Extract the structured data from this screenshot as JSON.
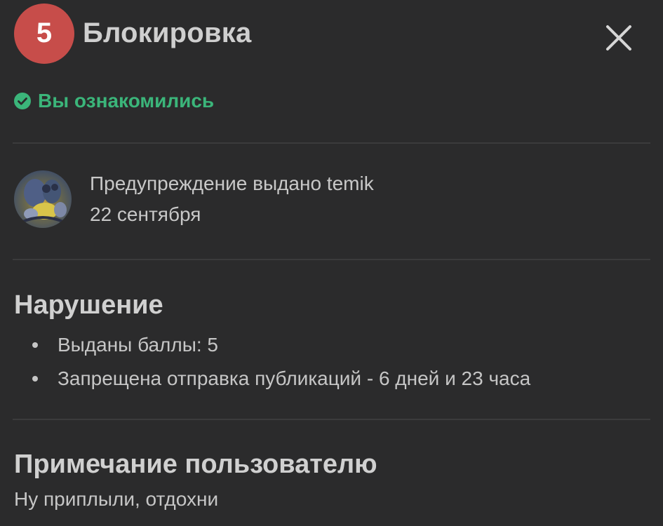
{
  "header": {
    "badge_number": "5",
    "title": "Блокировка",
    "close_icon": "close-icon"
  },
  "status": {
    "icon": "check-circle-icon",
    "text": "Вы ознакомились",
    "color": "#3bb57a"
  },
  "warning": {
    "issued_by_text": "Предупреждение выдано temik",
    "date": "22 сентября",
    "avatar_icon": "avatar-image"
  },
  "violation": {
    "title": "Нарушение",
    "items": [
      "Выданы баллы: 5",
      "Запрещена отправка публикаций - 6 дней и 23 часа"
    ]
  },
  "note": {
    "title": "Примечание пользователю",
    "text": "Ну приплыли, отдохни"
  },
  "colors": {
    "background": "#2b2b2c",
    "badge": "#c74d4a",
    "accent": "#3bb57a"
  }
}
